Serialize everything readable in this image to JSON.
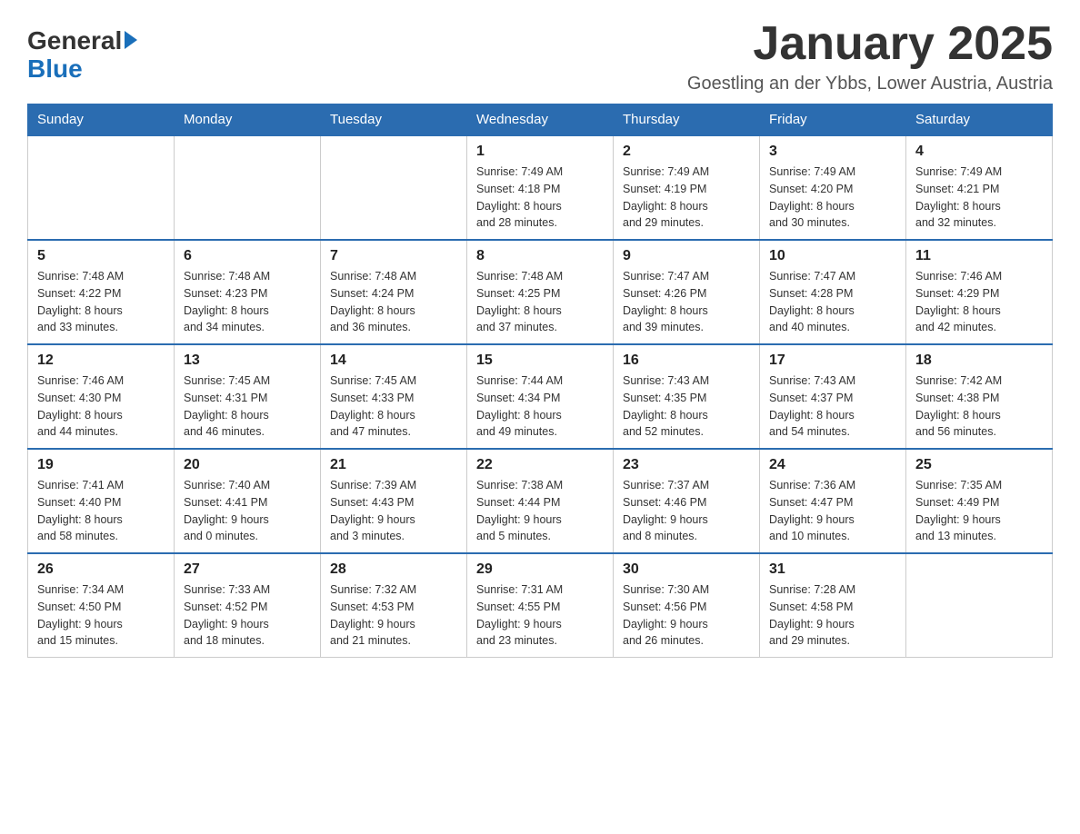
{
  "header": {
    "logo_general": "General",
    "logo_blue": "Blue",
    "month_title": "January 2025",
    "location": "Goestling an der Ybbs, Lower Austria, Austria"
  },
  "weekdays": [
    "Sunday",
    "Monday",
    "Tuesday",
    "Wednesday",
    "Thursday",
    "Friday",
    "Saturday"
  ],
  "weeks": [
    [
      {
        "day": "",
        "info": ""
      },
      {
        "day": "",
        "info": ""
      },
      {
        "day": "",
        "info": ""
      },
      {
        "day": "1",
        "info": "Sunrise: 7:49 AM\nSunset: 4:18 PM\nDaylight: 8 hours\nand 28 minutes."
      },
      {
        "day": "2",
        "info": "Sunrise: 7:49 AM\nSunset: 4:19 PM\nDaylight: 8 hours\nand 29 minutes."
      },
      {
        "day": "3",
        "info": "Sunrise: 7:49 AM\nSunset: 4:20 PM\nDaylight: 8 hours\nand 30 minutes."
      },
      {
        "day": "4",
        "info": "Sunrise: 7:49 AM\nSunset: 4:21 PM\nDaylight: 8 hours\nand 32 minutes."
      }
    ],
    [
      {
        "day": "5",
        "info": "Sunrise: 7:48 AM\nSunset: 4:22 PM\nDaylight: 8 hours\nand 33 minutes."
      },
      {
        "day": "6",
        "info": "Sunrise: 7:48 AM\nSunset: 4:23 PM\nDaylight: 8 hours\nand 34 minutes."
      },
      {
        "day": "7",
        "info": "Sunrise: 7:48 AM\nSunset: 4:24 PM\nDaylight: 8 hours\nand 36 minutes."
      },
      {
        "day": "8",
        "info": "Sunrise: 7:48 AM\nSunset: 4:25 PM\nDaylight: 8 hours\nand 37 minutes."
      },
      {
        "day": "9",
        "info": "Sunrise: 7:47 AM\nSunset: 4:26 PM\nDaylight: 8 hours\nand 39 minutes."
      },
      {
        "day": "10",
        "info": "Sunrise: 7:47 AM\nSunset: 4:28 PM\nDaylight: 8 hours\nand 40 minutes."
      },
      {
        "day": "11",
        "info": "Sunrise: 7:46 AM\nSunset: 4:29 PM\nDaylight: 8 hours\nand 42 minutes."
      }
    ],
    [
      {
        "day": "12",
        "info": "Sunrise: 7:46 AM\nSunset: 4:30 PM\nDaylight: 8 hours\nand 44 minutes."
      },
      {
        "day": "13",
        "info": "Sunrise: 7:45 AM\nSunset: 4:31 PM\nDaylight: 8 hours\nand 46 minutes."
      },
      {
        "day": "14",
        "info": "Sunrise: 7:45 AM\nSunset: 4:33 PM\nDaylight: 8 hours\nand 47 minutes."
      },
      {
        "day": "15",
        "info": "Sunrise: 7:44 AM\nSunset: 4:34 PM\nDaylight: 8 hours\nand 49 minutes."
      },
      {
        "day": "16",
        "info": "Sunrise: 7:43 AM\nSunset: 4:35 PM\nDaylight: 8 hours\nand 52 minutes."
      },
      {
        "day": "17",
        "info": "Sunrise: 7:43 AM\nSunset: 4:37 PM\nDaylight: 8 hours\nand 54 minutes."
      },
      {
        "day": "18",
        "info": "Sunrise: 7:42 AM\nSunset: 4:38 PM\nDaylight: 8 hours\nand 56 minutes."
      }
    ],
    [
      {
        "day": "19",
        "info": "Sunrise: 7:41 AM\nSunset: 4:40 PM\nDaylight: 8 hours\nand 58 minutes."
      },
      {
        "day": "20",
        "info": "Sunrise: 7:40 AM\nSunset: 4:41 PM\nDaylight: 9 hours\nand 0 minutes."
      },
      {
        "day": "21",
        "info": "Sunrise: 7:39 AM\nSunset: 4:43 PM\nDaylight: 9 hours\nand 3 minutes."
      },
      {
        "day": "22",
        "info": "Sunrise: 7:38 AM\nSunset: 4:44 PM\nDaylight: 9 hours\nand 5 minutes."
      },
      {
        "day": "23",
        "info": "Sunrise: 7:37 AM\nSunset: 4:46 PM\nDaylight: 9 hours\nand 8 minutes."
      },
      {
        "day": "24",
        "info": "Sunrise: 7:36 AM\nSunset: 4:47 PM\nDaylight: 9 hours\nand 10 minutes."
      },
      {
        "day": "25",
        "info": "Sunrise: 7:35 AM\nSunset: 4:49 PM\nDaylight: 9 hours\nand 13 minutes."
      }
    ],
    [
      {
        "day": "26",
        "info": "Sunrise: 7:34 AM\nSunset: 4:50 PM\nDaylight: 9 hours\nand 15 minutes."
      },
      {
        "day": "27",
        "info": "Sunrise: 7:33 AM\nSunset: 4:52 PM\nDaylight: 9 hours\nand 18 minutes."
      },
      {
        "day": "28",
        "info": "Sunrise: 7:32 AM\nSunset: 4:53 PM\nDaylight: 9 hours\nand 21 minutes."
      },
      {
        "day": "29",
        "info": "Sunrise: 7:31 AM\nSunset: 4:55 PM\nDaylight: 9 hours\nand 23 minutes."
      },
      {
        "day": "30",
        "info": "Sunrise: 7:30 AM\nSunset: 4:56 PM\nDaylight: 9 hours\nand 26 minutes."
      },
      {
        "day": "31",
        "info": "Sunrise: 7:28 AM\nSunset: 4:58 PM\nDaylight: 9 hours\nand 29 minutes."
      },
      {
        "day": "",
        "info": ""
      }
    ]
  ]
}
